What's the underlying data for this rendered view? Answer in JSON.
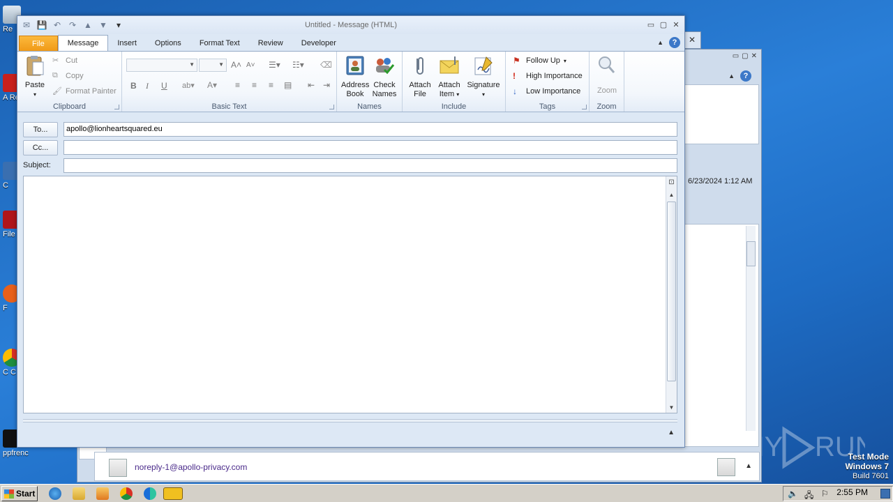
{
  "window": {
    "title": "Untitled  -  Message (HTML)"
  },
  "tabs": [
    {
      "label": "File"
    },
    {
      "label": "Message"
    },
    {
      "label": "Insert"
    },
    {
      "label": "Options"
    },
    {
      "label": "Format Text"
    },
    {
      "label": "Review"
    },
    {
      "label": "Developer"
    }
  ],
  "ribbon": {
    "clipboard": {
      "paste": "Paste",
      "cut": "Cut",
      "copy": "Copy",
      "format_painter": "Format Painter",
      "label": "Clipboard"
    },
    "basic_text": {
      "label": "Basic Text",
      "bold": "B",
      "italic": "I",
      "underline": "U"
    },
    "names": {
      "address_book": "Address Book",
      "address_line1": "Address",
      "address_line2": "Book",
      "check_line1": "Check",
      "check_line2": "Names",
      "label": "Names"
    },
    "include": {
      "attach_file1": "Attach",
      "attach_file2": "File",
      "attach_item1": "Attach",
      "attach_item2": "Item",
      "signature": "Signature",
      "label": "Include"
    },
    "tags": {
      "follow_up": "Follow Up",
      "high": "High Importance",
      "low": "Low Importance",
      "label": "Tags"
    },
    "zoom": {
      "zoom": "Zoom",
      "label": "Zoom"
    }
  },
  "fields": {
    "to_button": "To...",
    "to_value": "apollo@lionheartsquared.eu",
    "cc_button": "Cc...",
    "cc_value": "",
    "subject_label": "Subject:",
    "subject_value": ""
  },
  "background": {
    "date": "6/23/2024 1:12 AM",
    "sender": "noreply-1@apollo-privacy.com"
  },
  "desktop": {
    "icons": [
      "Re",
      "A Re",
      "C",
      "File",
      "F",
      "C C",
      "ppfrenc"
    ],
    "watermark": {
      "line1": "Test Mode",
      "line2": "Windows 7",
      "line3": "Build 7601"
    }
  },
  "taskbar": {
    "start": "Start",
    "clock": "2:55 PM"
  },
  "colors": {
    "file_tab": "#f09a18",
    "ribbon_bg": "#f3f7fc",
    "desktop": "#2a7fd8"
  }
}
